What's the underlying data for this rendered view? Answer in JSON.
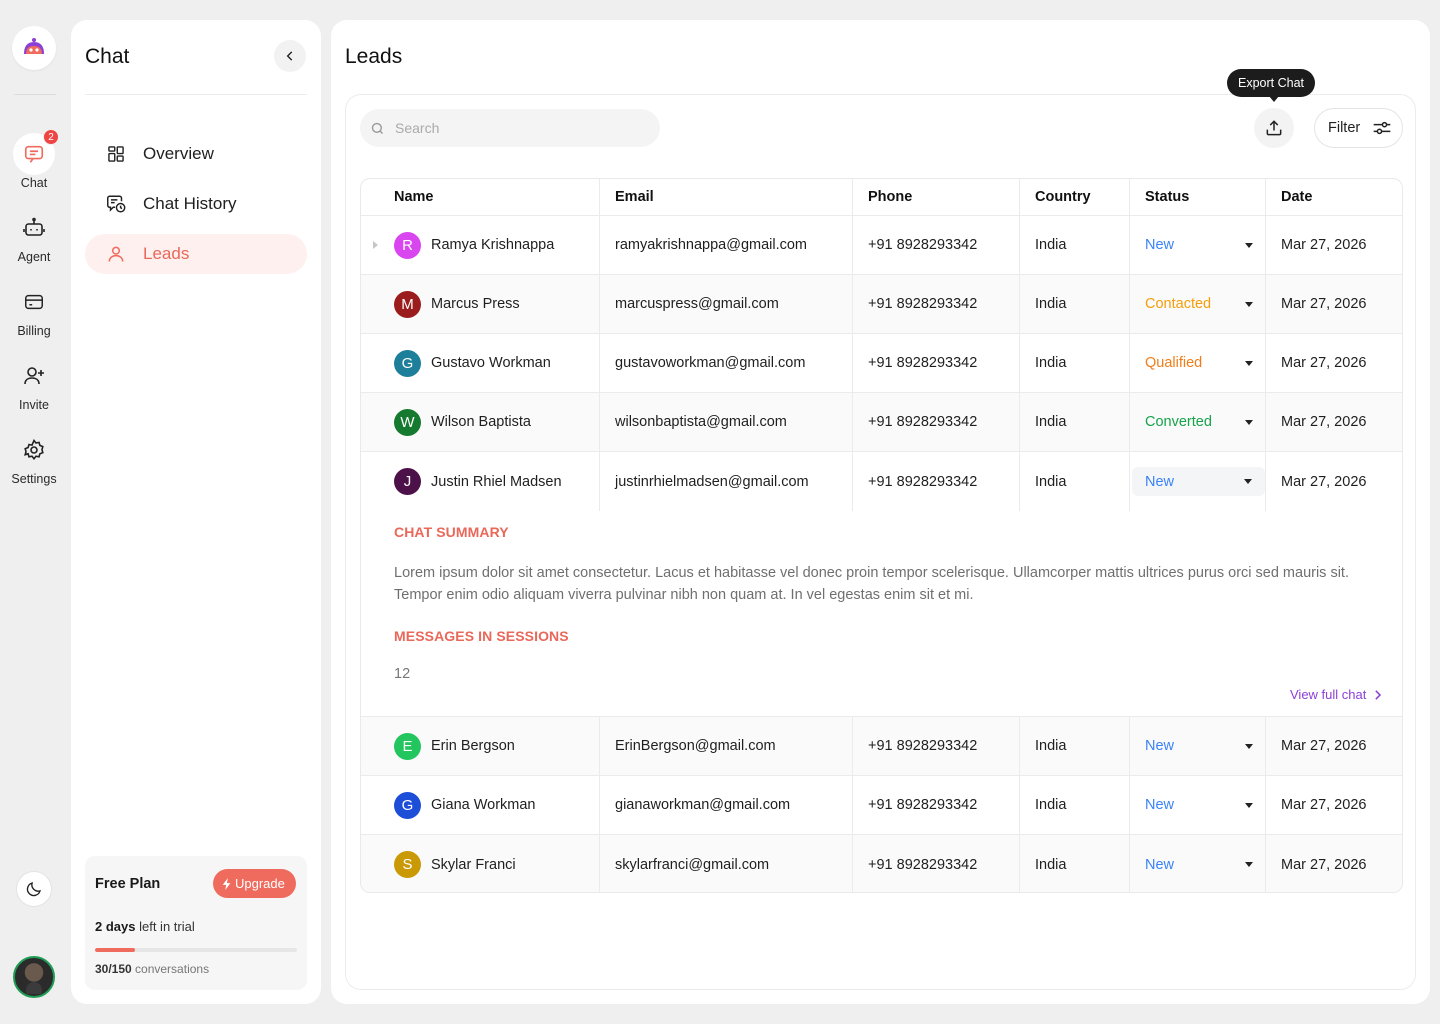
{
  "rail": {
    "items": [
      {
        "label": "Chat",
        "icon": "chat-icon",
        "badge": "2",
        "active": true
      },
      {
        "label": "Agent",
        "icon": "robot-icon"
      },
      {
        "label": "Billing",
        "icon": "card-icon"
      },
      {
        "label": "Invite",
        "icon": "user-plus-icon"
      },
      {
        "label": "Settings",
        "icon": "gear-icon"
      }
    ]
  },
  "panel": {
    "title": "Chat",
    "nav": [
      {
        "label": "Overview",
        "icon": "grid-icon"
      },
      {
        "label": "Chat History",
        "icon": "chat-history-icon"
      },
      {
        "label": "Leads",
        "icon": "user-icon",
        "active": true
      }
    ],
    "plan": {
      "title": "Free Plan",
      "upgrade_label": "Upgrade",
      "trial_days": "2 days",
      "trial_suffix": " left in trial",
      "progress": 0.2,
      "conversations_used": "30/150",
      "conversations_suffix": " conversations"
    }
  },
  "main": {
    "title": "Leads",
    "search": {
      "placeholder": "Search"
    },
    "tooltip": "Export Chat",
    "filter_label": "Filter",
    "columns": [
      "Name",
      "Email",
      "Phone",
      "Country",
      "Status",
      "Date"
    ],
    "rows": [
      {
        "initial": "R",
        "color": "#d946ef",
        "name": "Ramya Krishnappa",
        "email": "ramyakrishnappa@gmail.com",
        "phone": "+91 8928293342",
        "country": "India",
        "status": "New",
        "status_color": "#3b82f6",
        "date": "Mar 27, 2026"
      },
      {
        "initial": "M",
        "color": "#9b1c1c",
        "name": "Marcus Press",
        "email": "marcuspress@gmail.com",
        "phone": "+91 8928293342",
        "country": "India",
        "status": "Contacted",
        "status_color": "#f59e0b",
        "date": "Mar 27, 2026"
      },
      {
        "initial": "G",
        "color": "#1e7f9a",
        "name": "Gustavo Workman",
        "email": "gustavoworkman@gmail.com",
        "phone": "+91 8928293342",
        "country": "India",
        "status": "Qualified",
        "status_color": "#f07e1a",
        "date": "Mar 27, 2026"
      },
      {
        "initial": "W",
        "color": "#157a2f",
        "name": "Wilson Baptista",
        "email": "wilsonbaptista@gmail.com",
        "phone": "+91 8928293342",
        "country": "India",
        "status": "Converted",
        "status_color": "#16a34a",
        "date": "Mar 27, 2026"
      },
      {
        "initial": "J",
        "color": "#4c1149",
        "name": "Justin Rhiel Madsen",
        "email": "justinrhielmadsen@gmail.com",
        "phone": "+91 8928293342",
        "country": "India",
        "status": "New",
        "status_color": "#3b82f6",
        "date": "Mar 27, 2026"
      },
      {
        "initial": "E",
        "color": "#22c55e",
        "name": "Erin Bergson",
        "email": "ErinBergson@gmail.com",
        "phone": "+91 8928293342",
        "country": "India",
        "status": "New",
        "status_color": "#3b82f6",
        "date": "Mar 27, 2026"
      },
      {
        "initial": "G",
        "color": "#1d4ed8",
        "name": "Giana Workman",
        "email": "gianaworkman@gmail.com",
        "phone": "+91 8928293342",
        "country": "India",
        "status": "New",
        "status_color": "#3b82f6",
        "date": "Mar 27, 2026"
      },
      {
        "initial": "S",
        "color": "#c99a06",
        "name": "Skylar Franci",
        "email": "skylarfranci@gmail.com",
        "phone": "+91 8928293342",
        "country": "India",
        "status": "New",
        "status_color": "#3b82f6",
        "date": "Mar 27, 2026"
      }
    ],
    "detail": {
      "summary_heading": "CHAT SUMMARY",
      "summary_text": "Lorem ipsum dolor sit amet consectetur. Lacus et habitasse vel donec proin tempor scelerisque. Ullamcorper mattis ultrices purus orci sed mauris sit. Tempor enim odio aliquam viverra pulvinar nibh non quam at. In vel egestas enim sit et mi.",
      "messages_heading": "MESSAGES IN SESSIONS",
      "messages_count": "12",
      "view_full_label": "View full chat"
    }
  },
  "colors": {
    "accent": "#ef6b5e",
    "link": "#8b3fd6"
  }
}
